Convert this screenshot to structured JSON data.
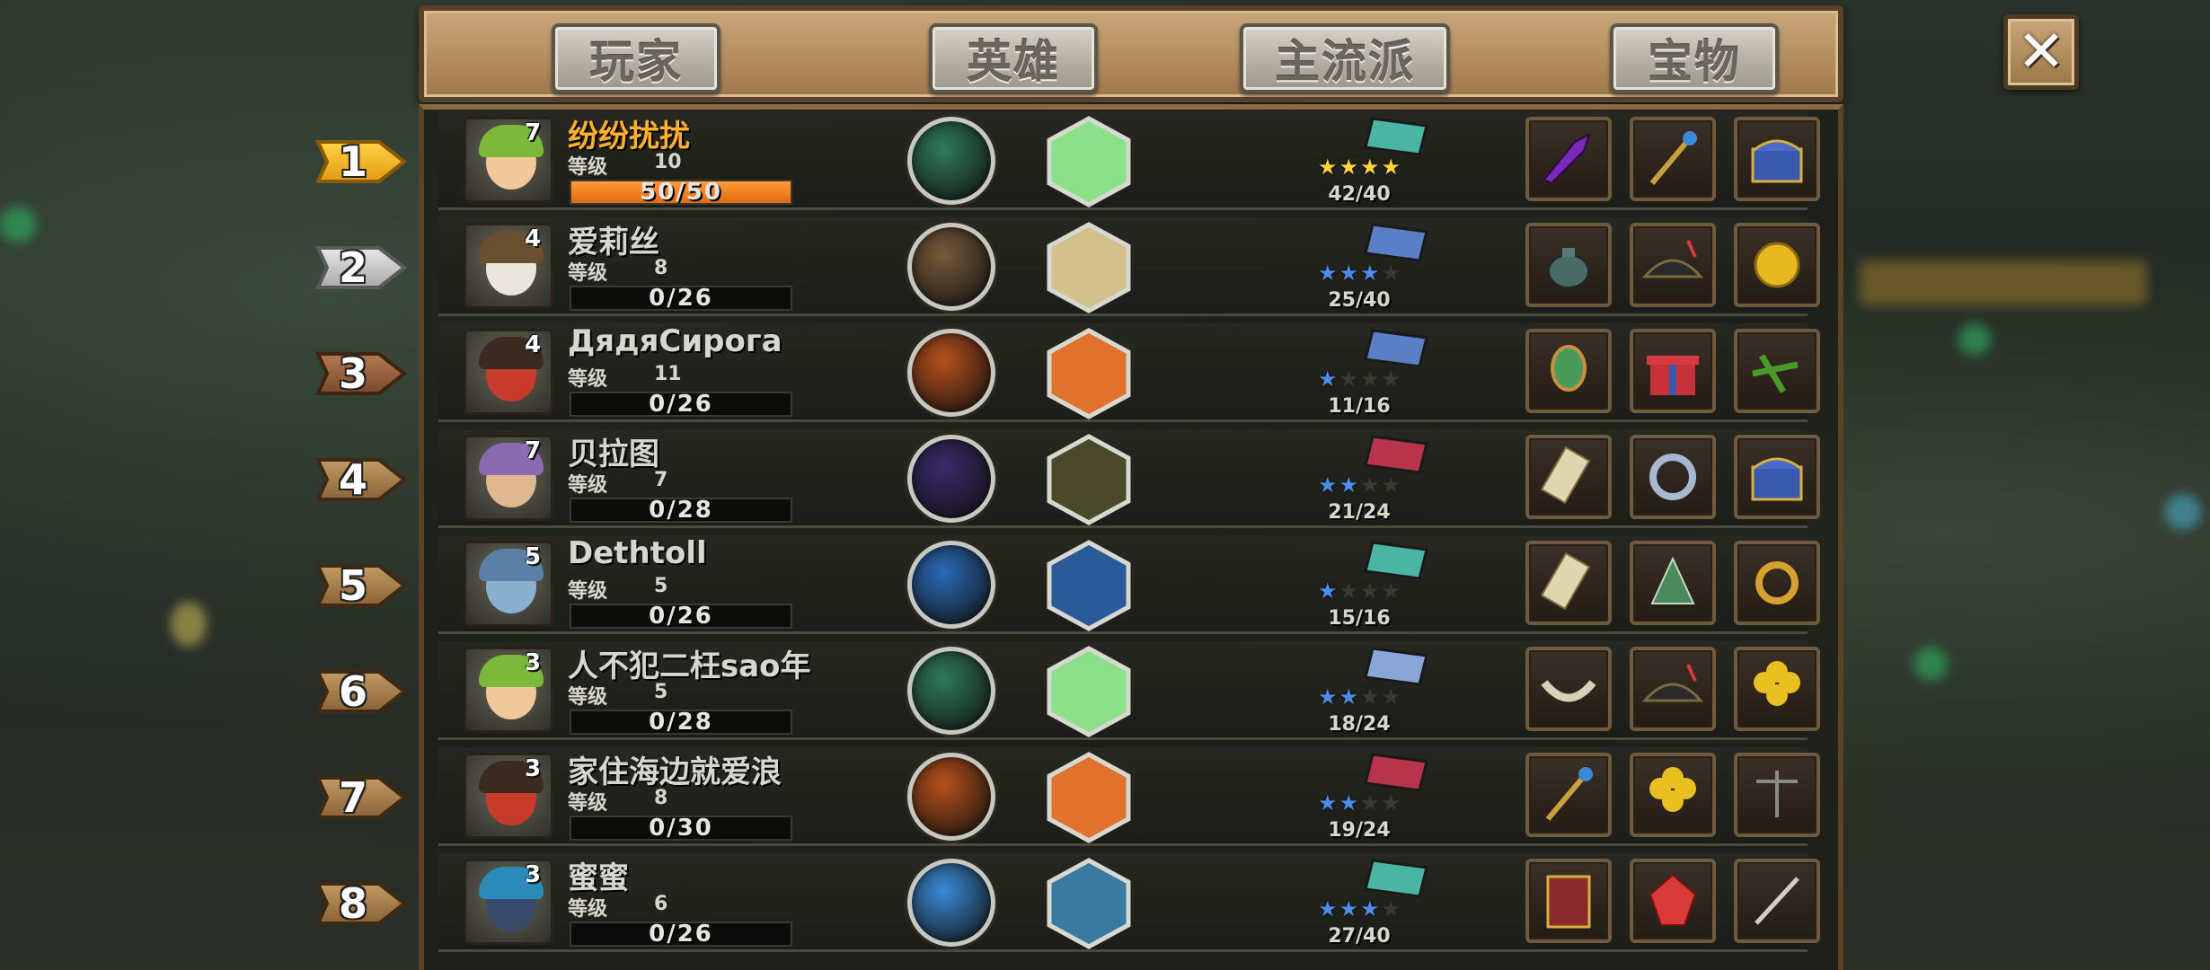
{
  "tabs": [
    {
      "label": "玩家"
    },
    {
      "label": "英雄"
    },
    {
      "label": "主流派"
    },
    {
      "label": "宝物"
    }
  ],
  "close_icon": "close-icon",
  "level_label": "等级",
  "rows": [
    {
      "rank": "1",
      "name": "纷纷扰扰",
      "level": "10",
      "avatar_level": "7",
      "xp_text": "50/50",
      "xp_fraction": 1.0,
      "stars_text": "42/40",
      "stars_filled": 4,
      "star_color": "gold",
      "book_color": "#49b5a2",
      "skill_color": "#2f7a5c",
      "hex_color": "#8be089",
      "hero": "elf",
      "treasures": [
        "purple-dagger-icon",
        "golden-scepter-icon",
        "treasure-chest-icon"
      ]
    },
    {
      "rank": "2",
      "name": "爱莉丝",
      "level": "8",
      "avatar_level": "4",
      "xp_text": "0/26",
      "xp_fraction": 0,
      "stars_text": "25/40",
      "stars_filled": 3,
      "star_color": "blue",
      "book_color": "#5b7fc4",
      "skill_color": "#7a5a3a",
      "hex_color": "#d3c08a",
      "hero": "panda",
      "treasures": [
        "teapot-icon",
        "pirate-hat-icon",
        "gold-coin-icon"
      ]
    },
    {
      "rank": "3",
      "name": "ДядяСирога",
      "level": "11",
      "avatar_level": "4",
      "xp_text": "0/26",
      "xp_fraction": 0,
      "stars_text": "11/16",
      "stars_filled": 1,
      "star_color": "blue",
      "book_color": "#5b7fc4",
      "skill_color": "#b8501a",
      "hex_color": "#e0722e",
      "hero": "orc",
      "treasures": [
        "green-mirror-icon",
        "gift-box-icon",
        "green-crossbow-icon"
      ]
    },
    {
      "rank": "4",
      "name": "贝拉图",
      "level": "7",
      "avatar_level": "7",
      "xp_text": "0/28",
      "xp_fraction": 0,
      "stars_text": "21/24",
      "stars_filled": 2,
      "star_color": "blue",
      "book_color": "#b8344a",
      "skill_color": "#3a2a6a",
      "hex_color": "#4a4a2a",
      "hero": "dwarf",
      "treasures": [
        "scroll-icon",
        "silver-ring-icon",
        "treasure-chest-icon"
      ]
    },
    {
      "rank": "5",
      "name": "Dethtoll",
      "level": "5",
      "avatar_level": "5",
      "xp_text": "0/26",
      "xp_fraction": 0,
      "stars_text": "15/16",
      "stars_filled": 1,
      "star_color": "blue",
      "book_color": "#49b5a2",
      "skill_color": "#2a6ab8",
      "hex_color": "#2a5a9a",
      "hero": "ghost",
      "treasures": [
        "map-scroll-icon",
        "green-cloak-icon",
        "gold-bracelet-icon"
      ]
    },
    {
      "rank": "6",
      "name": "人不犯二枉sao年",
      "level": "5",
      "avatar_level": "3",
      "xp_text": "0/28",
      "xp_fraction": 0,
      "stars_text": "18/24",
      "stars_filled": 2,
      "star_color": "blue",
      "book_color": "#8aa6d8",
      "skill_color": "#2f7a5c",
      "hex_color": "#8be089",
      "hero": "elf",
      "treasures": [
        "silver-horn-icon",
        "pirate-hat-icon",
        "clover-icon"
      ]
    },
    {
      "rank": "7",
      "name": "家住海边就爱浪",
      "level": "8",
      "avatar_level": "3",
      "xp_text": "0/30",
      "xp_fraction": 0,
      "stars_text": "19/24",
      "stars_filled": 2,
      "star_color": "blue",
      "book_color": "#b8344a",
      "skill_color": "#b8501a",
      "hex_color": "#e0722e",
      "hero": "orc",
      "treasures": [
        "staff-icon",
        "clover-icon",
        "scales-icon"
      ]
    },
    {
      "rank": "8",
      "name": "蜜蜜",
      "level": "6",
      "avatar_level": "3",
      "xp_text": "0/26",
      "xp_fraction": 0,
      "stars_text": "27/40",
      "stars_filled": 3,
      "star_color": "blue",
      "book_color": "#49b5a2",
      "skill_color": "#3a8ad8",
      "hex_color": "#3a7aa0",
      "hero": "penguin",
      "treasures": [
        "spellbook-icon",
        "red-gem-icon",
        "sword-icon"
      ]
    }
  ]
}
